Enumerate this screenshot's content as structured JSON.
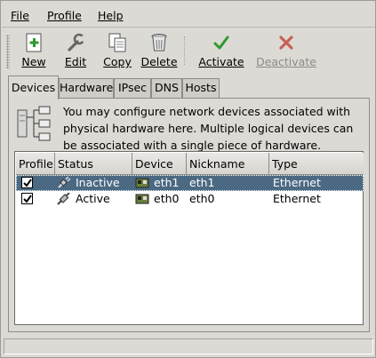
{
  "menubar": {
    "items": [
      {
        "label": "File"
      },
      {
        "label": "Profile"
      },
      {
        "label": "Help"
      }
    ]
  },
  "toolbar": {
    "buttons": [
      {
        "label": "New",
        "icon": "new-icon",
        "enabled": true
      },
      {
        "label": "Edit",
        "icon": "wrench-icon",
        "enabled": true
      },
      {
        "label": "Copy",
        "icon": "copy-icon",
        "enabled": true
      },
      {
        "label": "Delete",
        "icon": "trash-icon",
        "enabled": true
      },
      {
        "label": "Activate",
        "icon": "checkmark-icon",
        "enabled": true
      },
      {
        "label": "Deactivate",
        "icon": "red-x-icon",
        "enabled": false
      }
    ]
  },
  "tabs": [
    {
      "label": "Devices",
      "active": true
    },
    {
      "label": "Hardware",
      "active": false
    },
    {
      "label": "IPsec",
      "active": false
    },
    {
      "label": "DNS",
      "active": false
    },
    {
      "label": "Hosts",
      "active": false
    }
  ],
  "info": {
    "text": "You may configure network devices associated with physical hardware here.  Multiple logical devices can be associated with a single piece of hardware."
  },
  "devices_table": {
    "columns": [
      "Profile",
      "Status",
      "Device",
      "Nickname",
      "Type"
    ],
    "rows": [
      {
        "profile_checked": true,
        "status": "Inactive",
        "device": "eth1",
        "nickname": "eth1",
        "type": "Ethernet",
        "selected": true
      },
      {
        "profile_checked": true,
        "status": "Active",
        "device": "eth0",
        "nickname": "eth0",
        "type": "Ethernet",
        "selected": false
      }
    ]
  },
  "colors": {
    "window_bg": "#dcdad5",
    "selection_bg": "#4b6983",
    "activate_green": "#2e9a2e",
    "deactivate_red": "#c0392b"
  }
}
